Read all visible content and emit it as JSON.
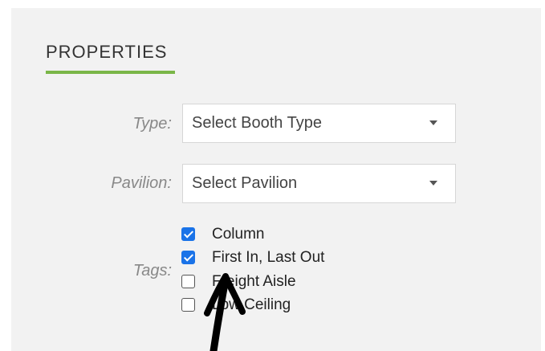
{
  "properties": {
    "title": "PROPERTIES",
    "accent_color": "#7ab648",
    "type": {
      "label": "Type:",
      "selected": "Select Booth Type"
    },
    "pavilion": {
      "label": "Pavilion:",
      "selected": "Select Pavilion"
    },
    "tags": {
      "label": "Tags:",
      "items": [
        {
          "label": "Column",
          "checked": true
        },
        {
          "label": "First In, Last Out",
          "checked": true
        },
        {
          "label": "Freight Aisle",
          "checked": false
        },
        {
          "label": "Low Ceiling",
          "checked": false
        }
      ]
    }
  },
  "annotation": {
    "icon": "hand-drawn-arrow-up-icon",
    "color": "#000000"
  }
}
